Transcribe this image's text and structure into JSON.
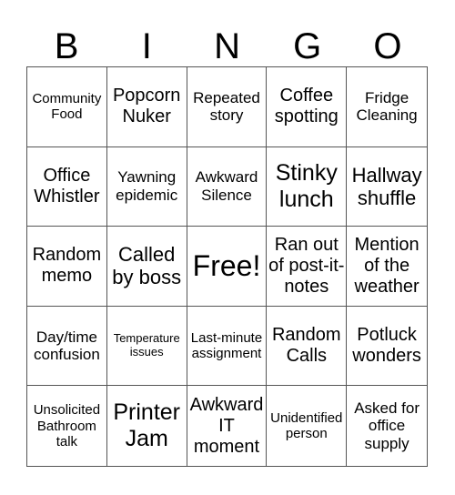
{
  "header": [
    "B",
    "I",
    "N",
    "G",
    "O"
  ],
  "cells": [
    "Community Food",
    "Popcorn Nuker",
    "Repeated story",
    "Coffee spotting",
    "Fridge Cleaning",
    "Office Whistler",
    "Yawning epidemic",
    "Awkward Silence",
    "Stinky lunch",
    "Hallway shuffle",
    "Random memo",
    "Called by boss",
    "Free!",
    "Ran out of post-it-notes",
    "Mention of the weather",
    "Day/time confusion",
    "Temperature issues",
    "Last-minute assignment",
    "Random Calls",
    "Potluck wonders",
    "Unsolicited Bathroom talk",
    "Printer Jam",
    "Awkward IT moment",
    "Unidentified person",
    "Asked for office supply"
  ]
}
